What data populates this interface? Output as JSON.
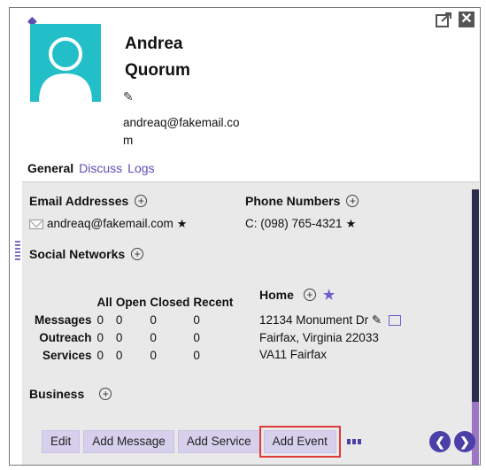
{
  "contact": {
    "first_name": "Andrea",
    "last_name": "Quorum",
    "email_wrapped_1": "andreaq@fakemail.co",
    "email_wrapped_2": "m"
  },
  "tabs": [
    {
      "label": "General",
      "active": true
    },
    {
      "label": "Discuss",
      "active": false
    },
    {
      "label": "Logs",
      "active": false
    }
  ],
  "email_section": {
    "title": "Email Addresses",
    "value": "andreaq@fakemail.com",
    "primary_mark": "★"
  },
  "phone_section": {
    "title": "Phone Numbers",
    "value": "C: (098) 765-4321",
    "primary_mark": "★"
  },
  "social_section": {
    "title": "Social Networks"
  },
  "stats": {
    "columns": [
      "All",
      "Open",
      "Closed",
      "Recent"
    ],
    "rows": [
      {
        "label": "Messages",
        "values": [
          "0",
          "0",
          "0",
          "0"
        ]
      },
      {
        "label": "Outreach",
        "values": [
          "0",
          "0",
          "0",
          "0"
        ]
      },
      {
        "label": "Services",
        "values": [
          "0",
          "0",
          "0",
          "0"
        ]
      }
    ]
  },
  "home": {
    "title": "Home",
    "line1": "12134 Monument Dr",
    "line2": "Fairfax, Virginia 22033",
    "line3": "VA11 Fairfax"
  },
  "business": {
    "title": "Business"
  },
  "toolbar": {
    "edit": "Edit",
    "add_message": "Add Message",
    "add_service": "Add Service",
    "add_event": "Add Event"
  },
  "colors": {
    "accent": "#4b3fa8",
    "avatar_bg": "#23bfc9",
    "button_bg": "#d6d0ec",
    "highlight": "#e03a3a"
  }
}
